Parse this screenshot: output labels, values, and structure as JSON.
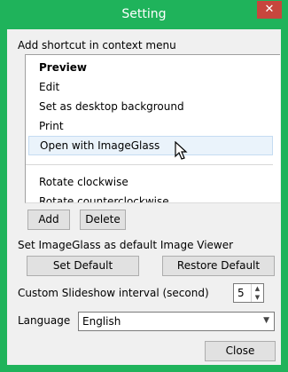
{
  "window": {
    "title": "Setting",
    "close_glyph": "✕"
  },
  "context_menu": {
    "label": "Add shortcut in context menu",
    "items": [
      {
        "label": "Preview"
      },
      {
        "label": "Edit"
      },
      {
        "label": "Set as desktop background"
      },
      {
        "label": "Print"
      },
      {
        "label": "Open with ImageGlass"
      },
      {
        "label": "Rotate clockwise"
      },
      {
        "label": "Rotate counterclockwise"
      }
    ],
    "add_label": "Add",
    "delete_label": "Delete"
  },
  "default_viewer": {
    "label": "Set ImageGlass as default Image Viewer",
    "set_default_label": "Set Default",
    "restore_default_label": "Restore Default"
  },
  "slideshow": {
    "label": "Custom Slideshow interval (second)",
    "value": "5"
  },
  "language": {
    "label": "Language",
    "value": "English"
  },
  "footer": {
    "close_label": "Close"
  },
  "colors": {
    "titlebar": "#1fb35b",
    "close_button": "#c7463d",
    "hover_item": "#eaf3fb"
  }
}
